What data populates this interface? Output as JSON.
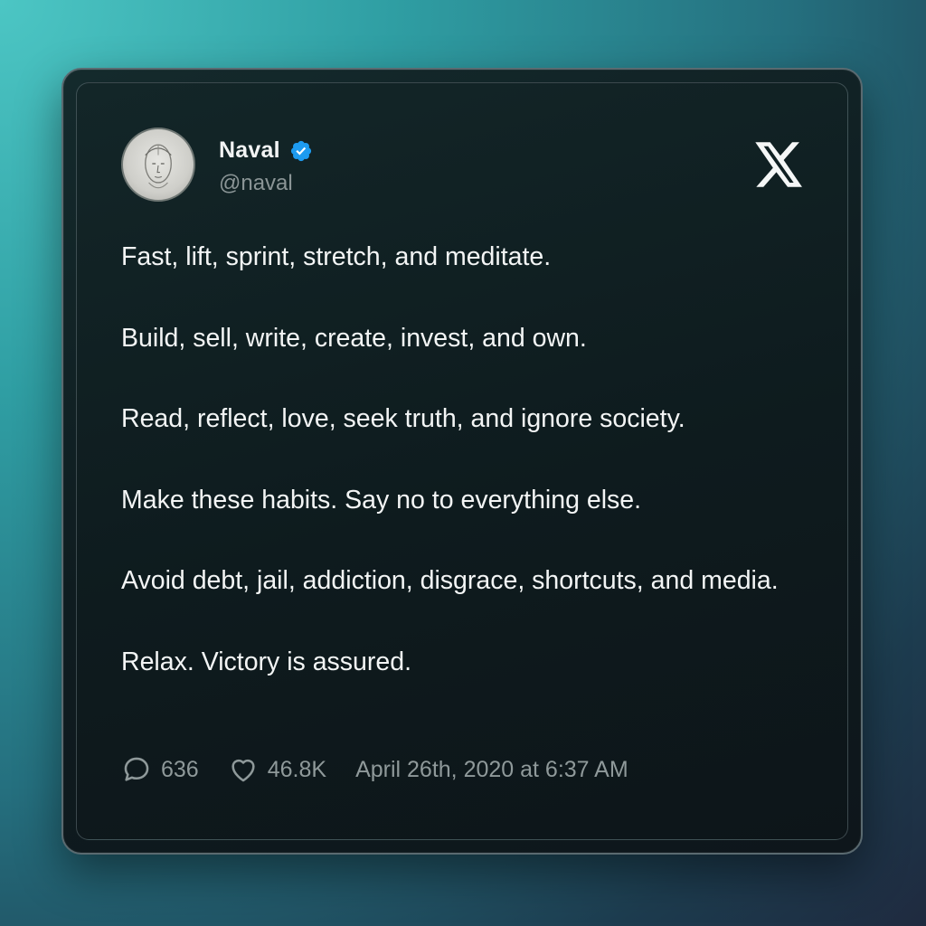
{
  "author": {
    "name": "Naval",
    "handle": "@naval",
    "verified": true
  },
  "brand": {
    "icon": "x-logo-icon"
  },
  "tweet": {
    "paragraphs": [
      "Fast, lift, sprint, stretch, and meditate.",
      "Build, sell, write, create, invest, and own.",
      "Read, reflect, love, seek truth, and ignore society.",
      "Make these habits. Say no to everything else.",
      "Avoid debt, jail, addiction, disgrace, shortcuts, and media.",
      "Relax. Victory is assured."
    ]
  },
  "stats": {
    "replies": "636",
    "likes": "46.8K",
    "timestamp": "April 26th, 2020 at 6:37 AM"
  },
  "colors": {
    "verified_badge": "#1d9bf0",
    "text_primary": "#f3f5f5",
    "text_secondary": "#8f999a"
  }
}
